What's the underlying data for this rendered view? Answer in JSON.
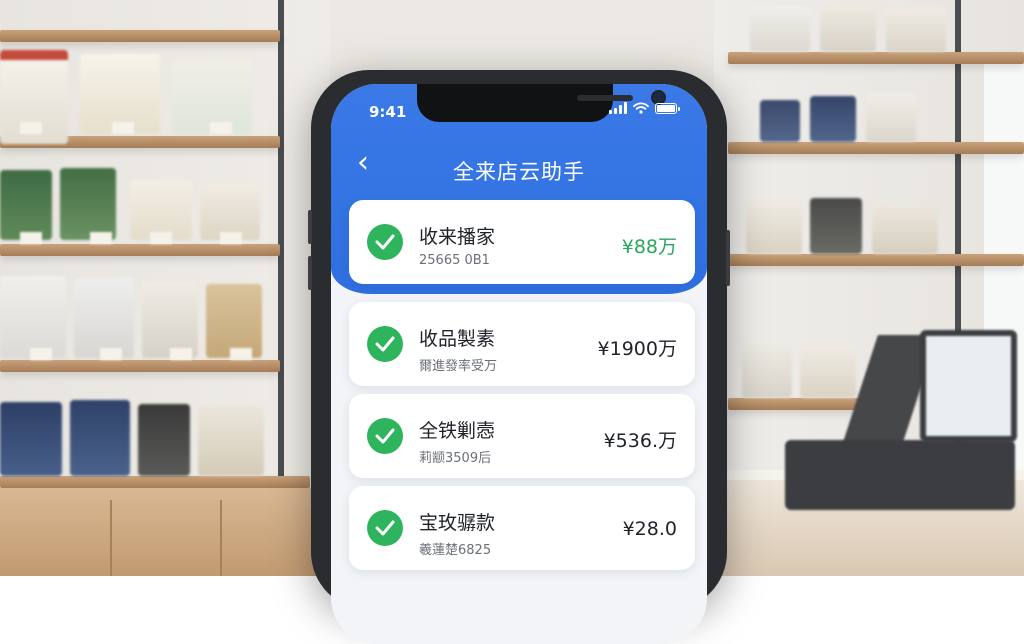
{
  "status_bar": {
    "time": "9:41"
  },
  "header": {
    "back_icon": "chevron-left-icon",
    "title": "全来店云助手"
  },
  "colors": {
    "brand_blue": "#2f6fe0",
    "success_green": "#2fb45e"
  },
  "records": [
    {
      "title": "收来播家",
      "subtitle": "25665 0B1",
      "amount": "¥88万",
      "amount_color": "green",
      "icon": "check-circle-icon"
    },
    {
      "title": "收品製素",
      "subtitle": "爾進發率受万",
      "amount": "¥1900万",
      "amount_color": "default",
      "icon": "check-circle-icon"
    },
    {
      "title": "全铁剿悫",
      "subtitle": "莉颛3509后",
      "amount": "¥536.万",
      "amount_color": "default",
      "icon": "check-circle-icon"
    },
    {
      "title": "宝玫骣款",
      "subtitle": "羲蓮楚6825",
      "amount": "¥28.0",
      "amount_color": "default",
      "icon": "check-circle-icon"
    }
  ]
}
